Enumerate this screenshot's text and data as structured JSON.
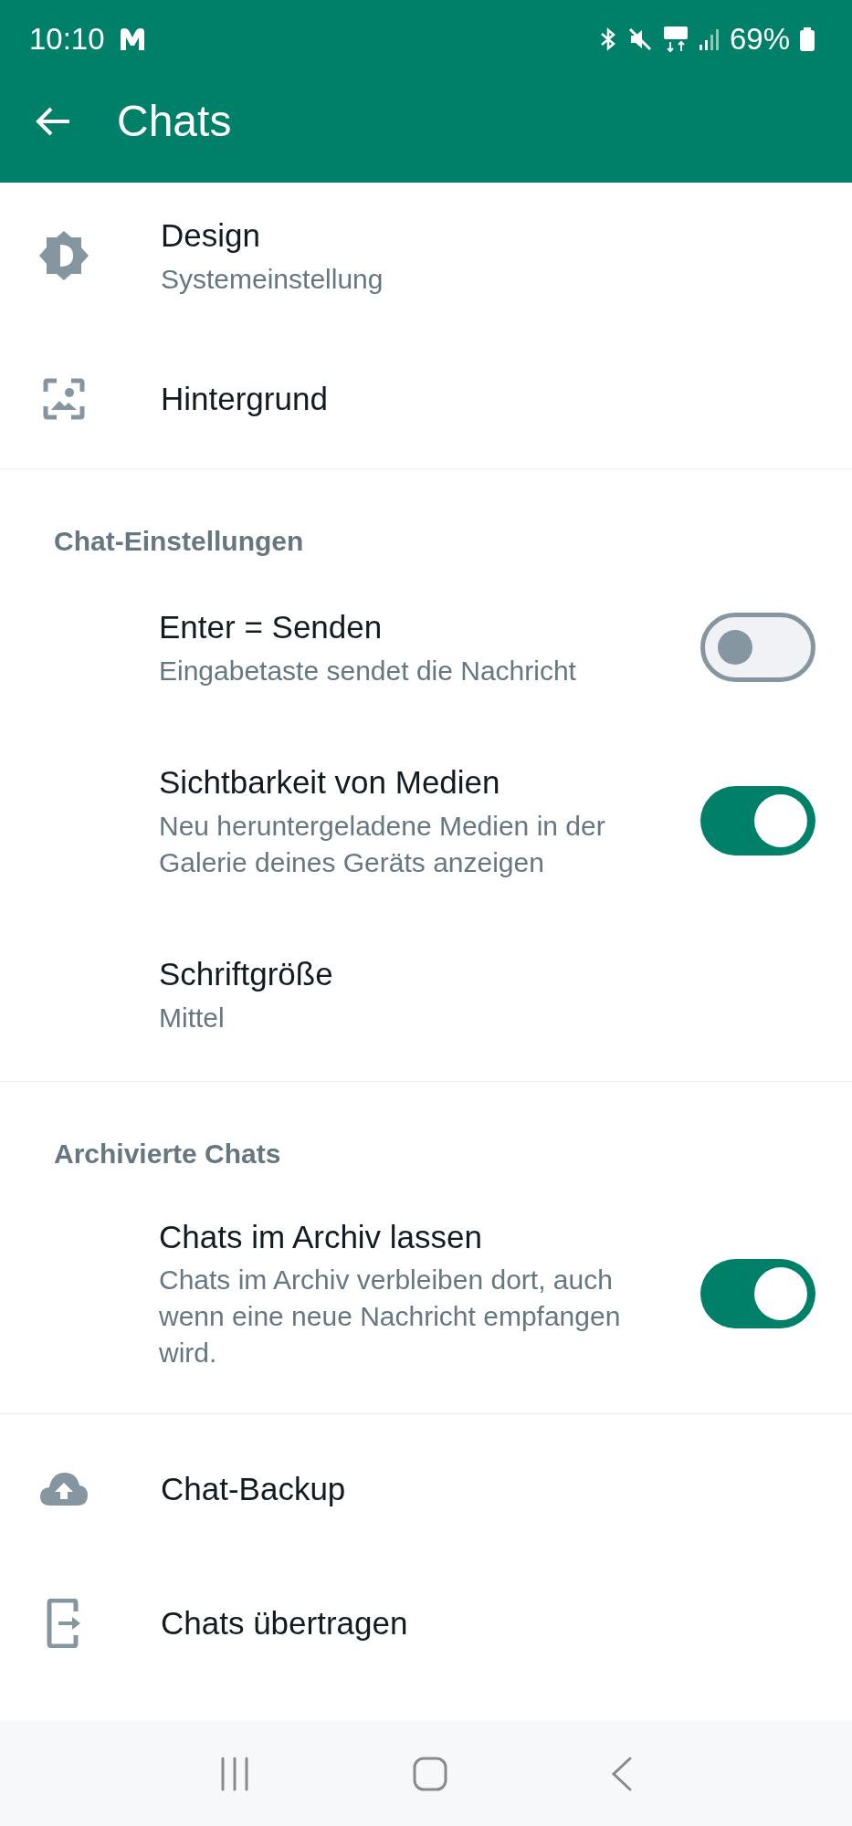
{
  "status_bar": {
    "time": "10:10",
    "battery": "69%"
  },
  "app_bar": {
    "title": "Chats"
  },
  "sections": [
    {
      "items": [
        {
          "kind": "link",
          "title": "Design",
          "subtitle": "Systemeinstellung"
        },
        {
          "kind": "link",
          "title": "Hintergrund"
        }
      ]
    },
    {
      "header": "Chat-Einstellungen",
      "items": [
        {
          "kind": "toggle",
          "title": "Enter = Senden",
          "subtitle": "Eingabetaste sendet die Nachricht",
          "on": false
        },
        {
          "kind": "toggle",
          "title": "Sichtbarkeit von Medien",
          "subtitle": "Neu heruntergeladene Medien in der Galerie deines Geräts anzeigen",
          "on": true
        },
        {
          "kind": "plain",
          "title": "Schriftgröße",
          "subtitle": "Mittel"
        }
      ]
    },
    {
      "header": "Archivierte Chats",
      "items": [
        {
          "kind": "toggle",
          "title": "Chats im Archiv lassen",
          "subtitle": "Chats im Archiv verbleiben dort, auch wenn eine neue Nachricht empfangen wird.",
          "on": true
        }
      ]
    },
    {
      "items": [
        {
          "kind": "link",
          "title": "Chat-Backup"
        },
        {
          "kind": "link",
          "title": "Chats übertragen"
        }
      ]
    }
  ]
}
